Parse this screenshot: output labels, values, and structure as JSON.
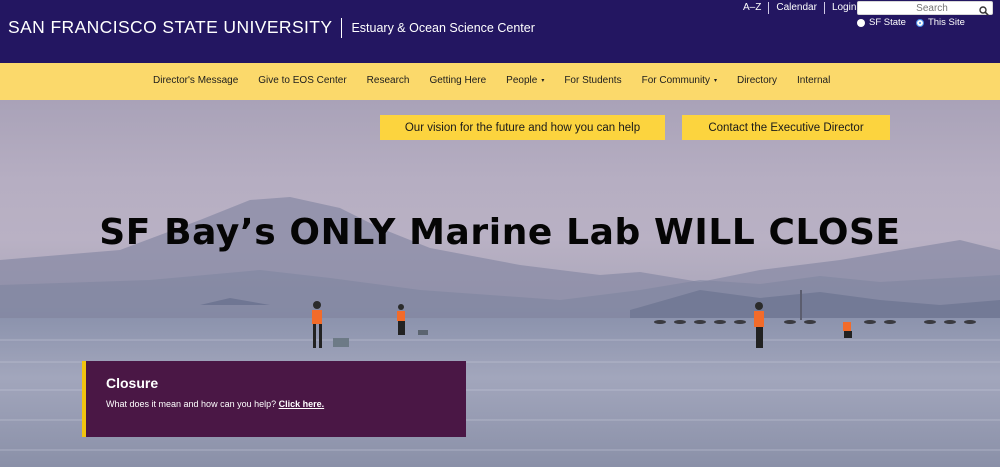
{
  "header": {
    "university": "SAN FRANCISCO STATE UNIVERSITY",
    "site_name": "Estuary & Ocean Science Center",
    "utility_links": [
      "A–Z",
      "Calendar",
      "Login"
    ],
    "search": {
      "placeholder": "Search"
    },
    "scope": {
      "options": [
        "SF State",
        "This Site"
      ],
      "selected": "This Site"
    }
  },
  "nav": {
    "items": [
      {
        "label": "Director's Message"
      },
      {
        "label": "Give to EOS Center"
      },
      {
        "label": "Research"
      },
      {
        "label": "Getting Here"
      },
      {
        "label": "People",
        "caret": "▾"
      },
      {
        "label": "For Students"
      },
      {
        "label": "For Community",
        "caret": "▾"
      },
      {
        "label": "Directory"
      },
      {
        "label": "Internal"
      }
    ]
  },
  "hero": {
    "buttons": [
      "Our vision for the future and how you can help",
      "Contact the Executive Director"
    ],
    "headline": "SF Bay’s ONLY Marine Lab WILL CLOSE",
    "closure": {
      "title": "Closure",
      "text": "What does it mean and how can you help?",
      "link": "Click here."
    }
  },
  "colors": {
    "header_bg": "#231661",
    "nav_bg": "#fbd96b",
    "cta_bg": "#fcd43e",
    "closure_bg": "#4a1745",
    "closure_accent": "#f1c40f"
  }
}
